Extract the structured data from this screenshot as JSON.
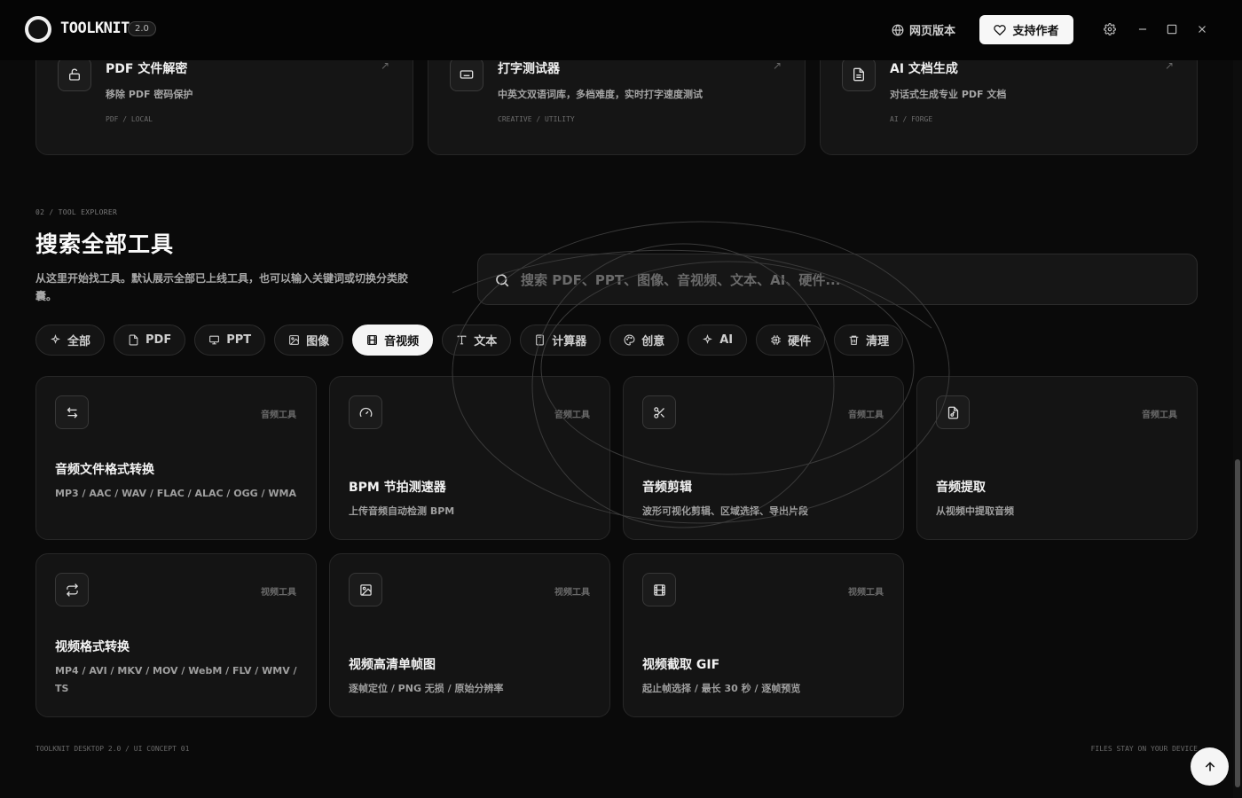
{
  "app": {
    "name": "TOOLKNIT",
    "version": "2.0"
  },
  "titlebar": {
    "web_version": "网页版本",
    "support": "支持作者"
  },
  "top_cards": [
    {
      "title": "PDF 文件解密",
      "desc": "移除 PDF 密码保护",
      "tag": "PDF / LOCAL",
      "icon": "unlock-icon"
    },
    {
      "title": "打字测试器",
      "desc": "中英文双语词库，多档难度，实时打字速度测试",
      "tag": "CREATIVE / UTILITY",
      "icon": "keyboard-icon"
    },
    {
      "title": "AI 文档生成",
      "desc": "对话式生成专业 PDF 文档",
      "tag": "AI / FORGE",
      "icon": "document-icon"
    }
  ],
  "section": {
    "label": "02 / TOOL EXPLORER",
    "title": "搜索全部工具",
    "desc": "从这里开始找工具。默认展示全部已上线工具，也可以输入关键词或切换分类胶囊。"
  },
  "search": {
    "placeholder": "搜索 PDF、PPT、图像、音视频、文本、AI、硬件..."
  },
  "chips": [
    {
      "label": "全部",
      "icon": "sparkle-icon"
    },
    {
      "label": "PDF",
      "icon": "file-icon"
    },
    {
      "label": "PPT",
      "icon": "presentation-icon"
    },
    {
      "label": "图像",
      "icon": "image-icon"
    },
    {
      "label": "音视频",
      "icon": "film-icon",
      "active": true
    },
    {
      "label": "文本",
      "icon": "text-icon"
    },
    {
      "label": "计算器",
      "icon": "calculator-icon"
    },
    {
      "label": "创意",
      "icon": "palette-icon"
    },
    {
      "label": "AI",
      "icon": "sparkle-icon"
    },
    {
      "label": "硬件",
      "icon": "chip-icon"
    },
    {
      "label": "清理",
      "icon": "trash-icon"
    }
  ],
  "tools": [
    {
      "title": "音频文件格式转换",
      "desc": "MP3 / AAC / WAV / FLAC / ALAC / OGG / WMA",
      "category": "音频工具",
      "icon": "swap-icon"
    },
    {
      "title": "BPM 节拍测速器",
      "desc": "上传音频自动检测 BPM",
      "category": "音频工具",
      "icon": "gauge-icon"
    },
    {
      "title": "音频剪辑",
      "desc": "波形可视化剪辑、区域选择、导出片段",
      "category": "音频工具",
      "icon": "scissors-icon"
    },
    {
      "title": "音频提取",
      "desc": "从视频中提取音频",
      "category": "音频工具",
      "icon": "audio-file-icon"
    },
    {
      "title": "视频格式转换",
      "desc": "MP4 / AVI / MKV / MOV / WebM / FLV / WMV / TS",
      "category": "视频工具",
      "icon": "repeat-icon"
    },
    {
      "title": "视频高清单帧图",
      "desc": "逐帧定位 / PNG 无损 / 原始分辨率",
      "category": "视频工具",
      "icon": "image-icon"
    },
    {
      "title": "视频截取 GIF",
      "desc": "起止帧选择 / 最长 30 秒 / 逐帧预览",
      "category": "视频工具",
      "icon": "film-icon"
    }
  ],
  "footer": {
    "left": "TOOLKNIT DESKTOP 2.0 / UI CONCEPT 01",
    "right": "FILES STAY ON YOUR DEVICE"
  }
}
